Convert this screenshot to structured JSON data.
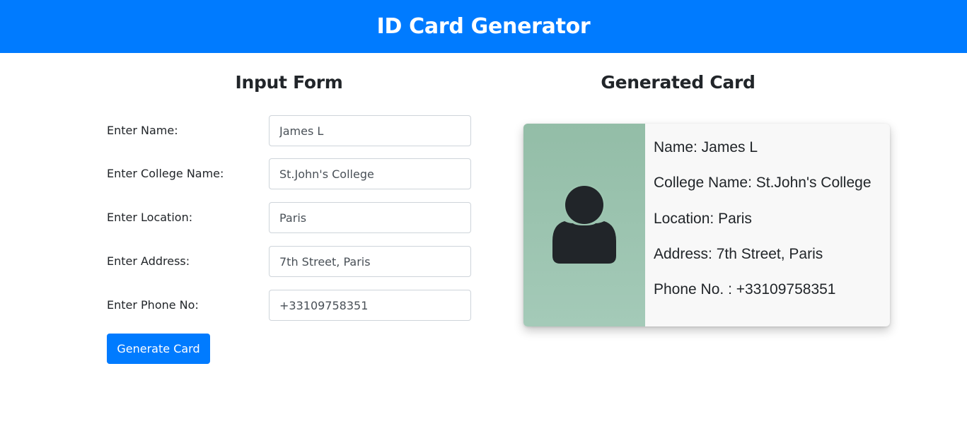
{
  "header": {
    "title": "ID Card Generator"
  },
  "form": {
    "title": "Input Form",
    "fields": [
      {
        "label": "Enter Name:",
        "value": "James L"
      },
      {
        "label": "Enter College Name:",
        "value": "St.John's College"
      },
      {
        "label": "Enter Location:",
        "value": "Paris"
      },
      {
        "label": "Enter Address:",
        "value": "7th Street, Paris"
      },
      {
        "label": "Enter Phone No:",
        "value": "+33109758351"
      }
    ],
    "submit_label": "Generate Card"
  },
  "card": {
    "title": "Generated Card",
    "photo_icon": "user-silhouette-icon",
    "lines": [
      "Name: James L",
      "College Name: St.John's College",
      "Location: Paris",
      "Address: 7th Street, Paris",
      "Phone No. : +33109758351"
    ]
  },
  "colors": {
    "primary": "#007bff",
    "photo_bg": "#9cc5b0",
    "icon": "#212529"
  }
}
